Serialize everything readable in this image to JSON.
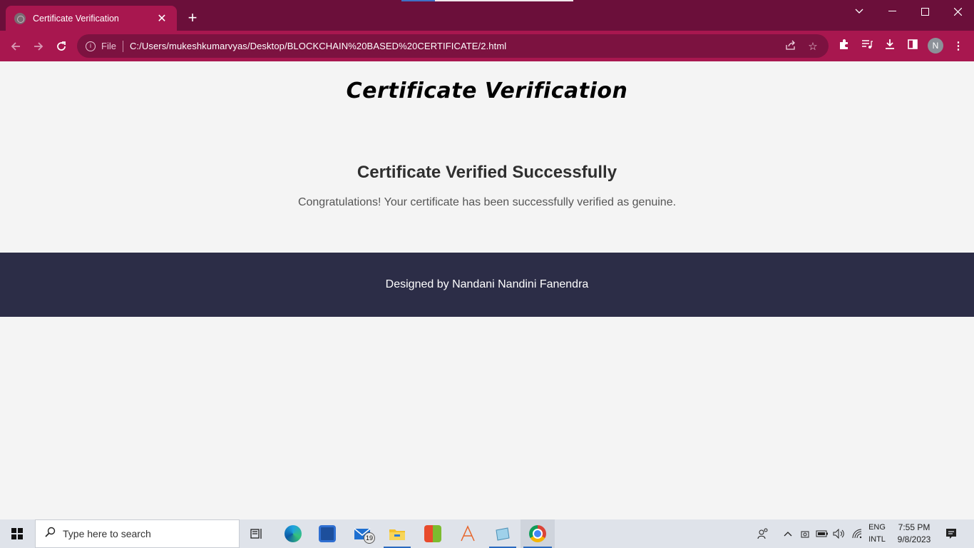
{
  "browser": {
    "tab_title": "Certificate Verification",
    "tab_close": "✕",
    "new_tab": "+",
    "scheme_label": "File",
    "url": "C:/Users/mukeshkumarvyas/Desktop/BLOCKCHAIN%20BASED%20CERTIFICATE/2.html",
    "profile_initial": "N",
    "accent_color": "#a8174f",
    "titlebar_color": "#6b0f3a"
  },
  "page": {
    "title": "Certificate Verification",
    "heading": "Certificate Verified Successfully",
    "message": "Congratulations! Your certificate has been successfully verified as genuine.",
    "footer_text": "Designed by Nandani Nandini Fanendra",
    "footer_color": "#2c2d47"
  },
  "taskbar": {
    "search_placeholder": "Type here to search",
    "mail_badge": "19",
    "language": "ENG",
    "keyboard_layout": "INTL",
    "time": "7:55 PM",
    "date": "9/8/2023"
  }
}
